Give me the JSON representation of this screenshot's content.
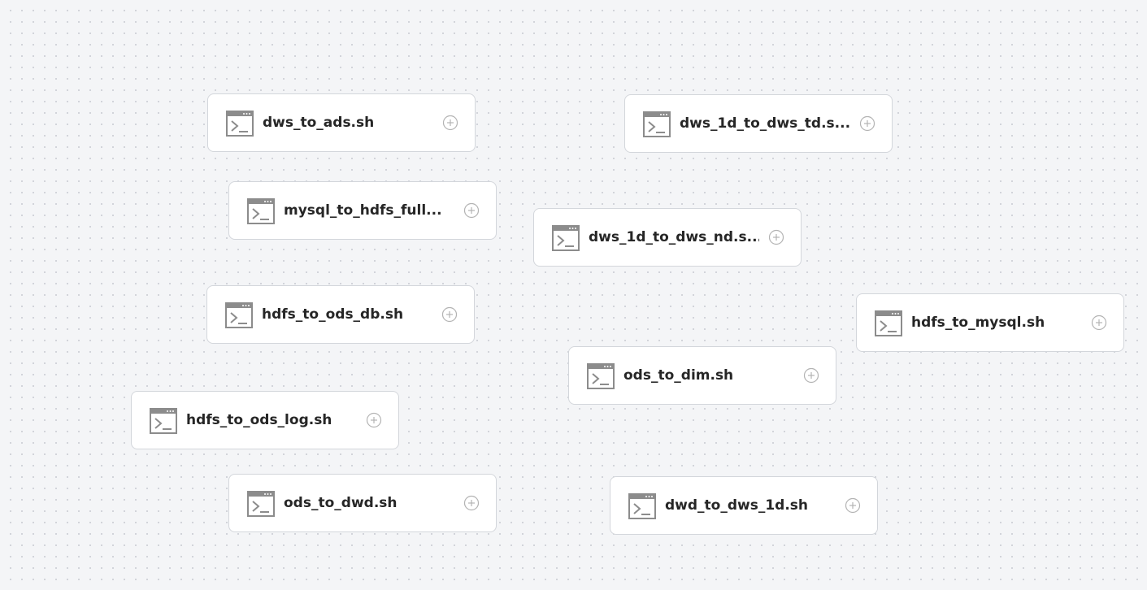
{
  "colors": {
    "canvas_bg": "#f4f5f7",
    "node_border": "#d3d6db",
    "icon": "#8c8c8c",
    "text": "#262626"
  },
  "nodes": [
    {
      "label": "dws_to_ads.sh",
      "icon": "terminal-icon",
      "action_icon": "add-circle-icon"
    },
    {
      "label": "dws_1d_to_dws_td.s...",
      "icon": "terminal-icon",
      "action_icon": "add-circle-icon"
    },
    {
      "label": "mysql_to_hdfs_full...",
      "icon": "terminal-icon",
      "action_icon": "add-circle-icon"
    },
    {
      "label": "dws_1d_to_dws_nd.s...",
      "icon": "terminal-icon",
      "action_icon": "add-circle-icon"
    },
    {
      "label": "hdfs_to_ods_db.sh",
      "icon": "terminal-icon",
      "action_icon": "add-circle-icon"
    },
    {
      "label": "hdfs_to_mysql.sh",
      "icon": "terminal-icon",
      "action_icon": "add-circle-icon"
    },
    {
      "label": "ods_to_dim.sh",
      "icon": "terminal-icon",
      "action_icon": "add-circle-icon"
    },
    {
      "label": "hdfs_to_ods_log.sh",
      "icon": "terminal-icon",
      "action_icon": "add-circle-icon"
    },
    {
      "label": "ods_to_dwd.sh",
      "icon": "terminal-icon",
      "action_icon": "add-circle-icon"
    },
    {
      "label": "dwd_to_dws_1d.sh",
      "icon": "terminal-icon",
      "action_icon": "add-circle-icon"
    }
  ]
}
